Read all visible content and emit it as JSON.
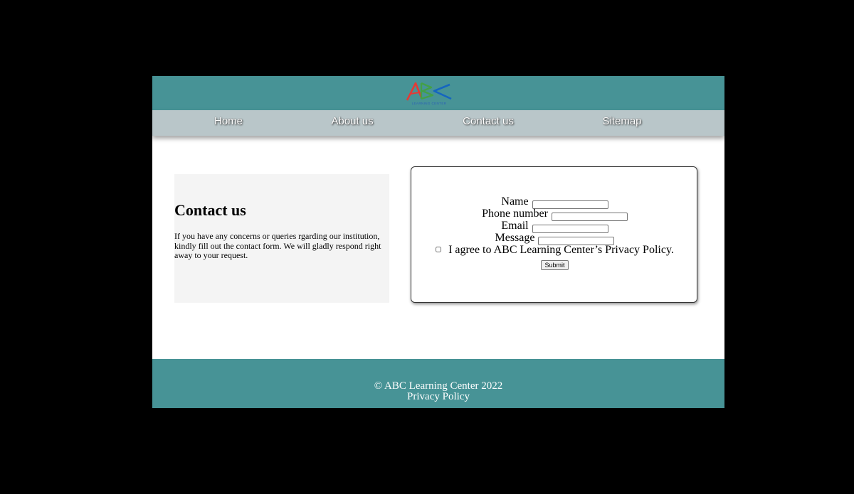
{
  "logo": {
    "caption": "LEARNING CENTER",
    "colors": {
      "a": "#e53935",
      "b": "#43a047",
      "c": "#1565c0"
    },
    "alt_text": "ABC"
  },
  "nav": {
    "items": [
      {
        "label": "Home"
      },
      {
        "label": "About us"
      },
      {
        "label": "Contact us"
      },
      {
        "label": "Sitemap"
      }
    ]
  },
  "intro": {
    "title": "Contact us",
    "text": "If you have any concerns or queries rgarding our institution, kindly fill out the contact form. We will gladly respond right away to your request."
  },
  "form": {
    "name_label": "Name",
    "name_value": "",
    "phone_label": "Phone number",
    "phone_value": "",
    "email_label": "Email",
    "email_value": "",
    "message_label": "Message",
    "message_value": "",
    "agree_label": "I agree to ABC Learning Center’s Privacy Policy.",
    "agree_checked": false,
    "submit_label": "Submit"
  },
  "footer": {
    "copyright": "© ABC Learning Center 2022",
    "privacy_link": "Privacy Policy"
  },
  "colors": {
    "header_bg": "#479396",
    "nav_bg": "#b9c6c9",
    "intro_bg": "#f4f4f4",
    "page_bg": "#000000"
  }
}
